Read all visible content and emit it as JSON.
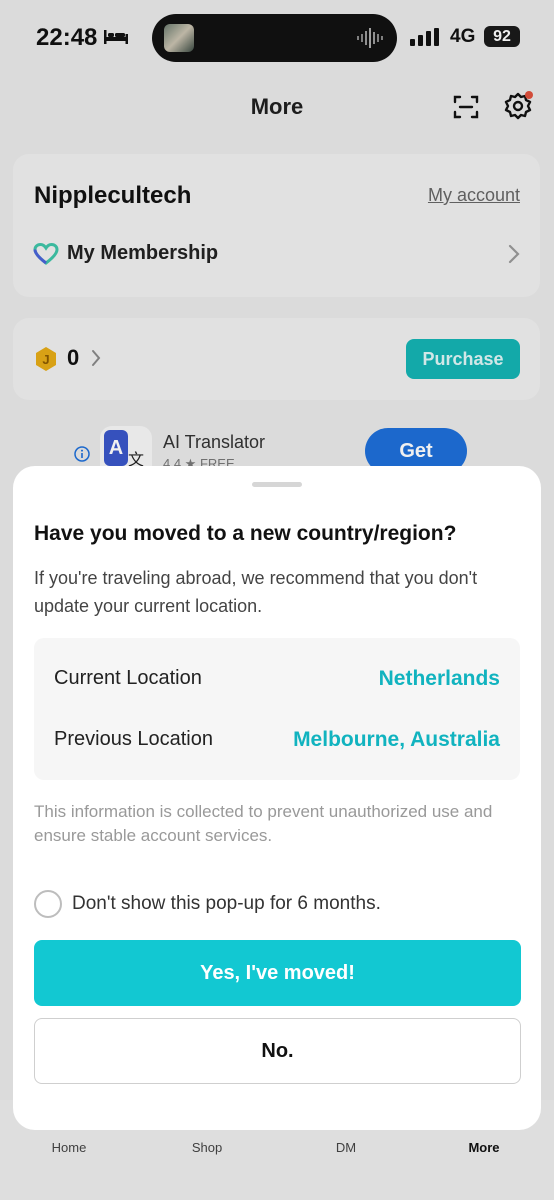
{
  "status_bar": {
    "time": "22:48",
    "network": "4G",
    "battery": "92"
  },
  "header": {
    "title": "More"
  },
  "account": {
    "username": "Nipplecultech",
    "my_account_link": "My account",
    "membership_label": "My Membership"
  },
  "coins": {
    "count": "0",
    "purchase_label": "Purchase"
  },
  "ad": {
    "app_name": "AI Translator",
    "rating": "4.4 ★  FREE",
    "get_label": "Get"
  },
  "tabbar": {
    "items": [
      {
        "label": "Home"
      },
      {
        "label": "Shop"
      },
      {
        "label": "DM"
      },
      {
        "label": "More"
      }
    ]
  },
  "modal": {
    "title": "Have you moved to a new country/region?",
    "description": "If you're traveling abroad, we recommend that you don't update your current location.",
    "current_location_label": "Current Location",
    "current_location_value": "Netherlands",
    "previous_location_label": "Previous Location",
    "previous_location_value": "Melbourne, Australia",
    "note": "This information is collected to prevent unauthorized use and ensure stable account services.",
    "checkbox_label": "Don't show this pop-up for 6 months.",
    "yes_button": "Yes, I've moved!",
    "no_button": "No."
  },
  "colors": {
    "accent": "#12c8d2",
    "location_value": "#11b3bf",
    "purchase_button": "#15b4b4",
    "ad_button": "#1e6fd9",
    "notification_dot": "#e0513d"
  },
  "icons": [
    "bed-icon",
    "audio-wave-icon",
    "signal-icon",
    "scan-icon",
    "gear-icon",
    "membership-heart-icon",
    "chevron-right-icon",
    "coin-icon",
    "info-icon",
    "translator-app-icon"
  ]
}
